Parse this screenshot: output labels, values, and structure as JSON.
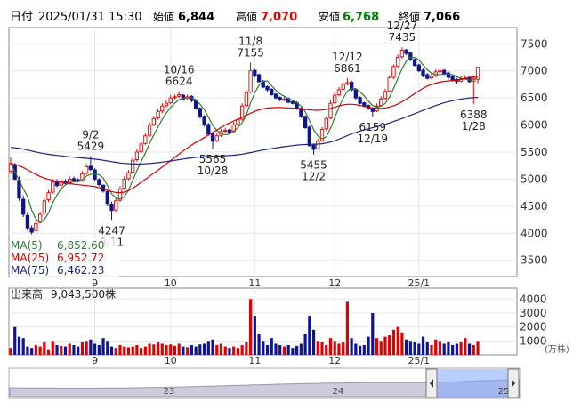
{
  "header": {
    "date_label": "日付",
    "datetime": "2025/01/31 15:30",
    "open_label": "始値",
    "open_value": "6,844",
    "high_label": "高値",
    "high_value": "7,070",
    "low_label": "安値",
    "low_value": "6,768",
    "close_label": "終値",
    "close_value": "7,066"
  },
  "legend": {
    "ma5_label": "MA(5)",
    "ma5_value": "6,852.60",
    "ma25_label": "MA(25)",
    "ma25_value": "6,952.72",
    "ma75_label": "MA(75)",
    "ma75_value": "6,462.23"
  },
  "volume_panel": {
    "label": "出来高",
    "value": "9,043,500株",
    "unit": "(万株)"
  },
  "colors": {
    "up": "#e00000",
    "down": "#10148c",
    "ma5": "#2e7d32",
    "ma25": "#d50000",
    "ma75": "#1a237e",
    "volume_up": "#e00000",
    "volume_down": "#0d1499"
  },
  "chart_data": {
    "type": "candlestick",
    "price_axis": {
      "ticks": [
        "3500",
        "4000",
        "4500",
        "5000",
        "5500",
        "6000",
        "6500",
        "7000",
        "7500"
      ],
      "ylim": [
        3200,
        7800
      ]
    },
    "volume_axis": {
      "ticks": [
        "1000",
        "2000",
        "3000",
        "4000"
      ],
      "ylim": [
        0,
        4400
      ]
    },
    "month_labels": [
      "9",
      "10",
      "11",
      "12",
      "25/1"
    ],
    "overview_labels": [
      "23",
      "24",
      "25"
    ],
    "annotations": [
      {
        "date": "9/2",
        "value": "5429"
      },
      {
        "date": "9/11",
        "value": "4247"
      },
      {
        "date": "10/16",
        "value": "6624"
      },
      {
        "date": "10/28",
        "value": "5565"
      },
      {
        "date": "11/8",
        "value": "7155"
      },
      {
        "date": "12/2",
        "value": "5455"
      },
      {
        "date": "12/12",
        "value": "6861"
      },
      {
        "date": "12/19",
        "value": "6159"
      },
      {
        "date": "12/27",
        "value": "7435"
      },
      {
        "date": "1/28",
        "value": "6388"
      }
    ],
    "close": [
      5290,
      5000,
      4650,
      4350,
      4100,
      4020,
      4180,
      4350,
      4600,
      4750,
      4950,
      4880,
      4950,
      4920,
      5000,
      4980,
      4960,
      5100,
      5230,
      5180,
      5000,
      4900,
      4780,
      4550,
      4420,
      4600,
      4820,
      5000,
      5120,
      5350,
      5500,
      5650,
      5800,
      6000,
      6120,
      6250,
      6350,
      6400,
      6500,
      6520,
      6560,
      6480,
      6520,
      6450,
      6300,
      6150,
      6000,
      5830,
      5700,
      5800,
      5880,
      5900,
      5870,
      6000,
      6100,
      6350,
      6600,
      7000,
      6920,
      6800,
      6700,
      6650,
      6560,
      6500,
      6460,
      6480,
      6420,
      6400,
      6300,
      6150,
      5950,
      5620,
      5550,
      5700,
      5920,
      6120,
      6400,
      6550,
      6650,
      6750,
      6780,
      6650,
      6500,
      6400,
      6350,
      6300,
      6250,
      6350,
      6480,
      6620,
      6870,
      7080,
      7250,
      7380,
      7320,
      7200,
      7100,
      7000,
      6920,
      6860,
      6900,
      6980,
      7000,
      6950,
      6880,
      6830,
      6800,
      6850,
      6870,
      6800,
      6860,
      7066
    ],
    "open": [
      5150,
      5270,
      4980,
      4630,
      4330,
      4100,
      4050,
      4200,
      4370,
      4620,
      4760,
      4960,
      4890,
      4960,
      4930,
      5010,
      4990,
      4970,
      5110,
      5240,
      5170,
      4990,
      4890,
      4770,
      4540,
      4430,
      4610,
      4830,
      5010,
      5130,
      5360,
      5510,
      5660,
      5810,
      6010,
      6130,
      6260,
      6360,
      6410,
      6510,
      6530,
      6550,
      6490,
      6530,
      6460,
      6310,
      6160,
      6010,
      5840,
      5710,
      5810,
      5890,
      5910,
      5880,
      6010,
      6110,
      6360,
      6610,
      7010,
      6930,
      6810,
      6710,
      6660,
      6570,
      6510,
      6470,
      6490,
      6430,
      6410,
      6310,
      6160,
      5960,
      5630,
      5560,
      5710,
      5930,
      6130,
      6410,
      6560,
      6660,
      6760,
      6790,
      6660,
      6510,
      6410,
      6360,
      6310,
      6260,
      6360,
      6490,
      6630,
      6880,
      7090,
      7260,
      7390,
      7330,
      7210,
      7110,
      7010,
      6930,
      6870,
      6910,
      6990,
      7010,
      6960,
      6890,
      6840,
      6810,
      6860,
      6880,
      6810,
      6844
    ],
    "high": [
      5400,
      5300,
      5050,
      4700,
      4400,
      4150,
      4250,
      4400,
      4650,
      4800,
      5000,
      5000,
      4990,
      5000,
      5050,
      5050,
      5020,
      5150,
      5280,
      5429,
      5200,
      5020,
      4900,
      4800,
      4580,
      4650,
      4870,
      5050,
      5170,
      5400,
      5550,
      5700,
      5850,
      6050,
      6170,
      6300,
      6400,
      6450,
      6550,
      6560,
      6624,
      6570,
      6560,
      6550,
      6480,
      6330,
      6180,
      6040,
      5870,
      5850,
      5920,
      5950,
      5930,
      6050,
      6150,
      6400,
      6650,
      7155,
      7030,
      6950,
      6830,
      6730,
      6680,
      6590,
      6530,
      6520,
      6510,
      6450,
      6440,
      6330,
      6180,
      5990,
      5660,
      5750,
      5960,
      6160,
      6450,
      6600,
      6700,
      6800,
      6861,
      6820,
      6680,
      6530,
      6430,
      6380,
      6330,
      6400,
      6530,
      6670,
      6920,
      7120,
      7300,
      7435,
      7400,
      7350,
      7230,
      7130,
      7040,
      6960,
      6950,
      7030,
      7050,
      7030,
      6990,
      6930,
      6870,
      6900,
      6920,
      6900,
      6900,
      7070
    ],
    "low": [
      5100,
      4980,
      4600,
      4300,
      4050,
      3980,
      4030,
      4180,
      4340,
      4580,
      4730,
      4850,
      4870,
      4900,
      4900,
      4950,
      4940,
      4950,
      5080,
      5150,
      4970,
      4870,
      4750,
      4500,
      4247,
      4400,
      4580,
      4800,
      4980,
      5100,
      5320,
      5480,
      5630,
      5780,
      5980,
      6100,
      6220,
      6330,
      6380,
      6480,
      6500,
      6450,
      6460,
      6420,
      6280,
      6120,
      5970,
      5800,
      5565,
      5680,
      5780,
      5860,
      5840,
      5860,
      5980,
      6080,
      6330,
      6580,
      6880,
      6780,
      6680,
      6620,
      6540,
      6480,
      6440,
      6440,
      6400,
      6380,
      6280,
      6130,
      5930,
      5600,
      5455,
      5540,
      5690,
      5900,
      6110,
      6380,
      6530,
      6640,
      6730,
      6620,
      6470,
      6380,
      6330,
      6280,
      6159,
      6240,
      6340,
      6460,
      6600,
      6850,
      7060,
      7230,
      7290,
      7180,
      7080,
      6980,
      6880,
      6840,
      6850,
      6880,
      6960,
      6920,
      6840,
      6800,
      6760,
      6790,
      6840,
      6780,
      6388,
      6768
    ],
    "volume": [
      500,
      2000,
      1300,
      1200,
      600,
      500,
      700,
      600,
      900,
      400,
      1000,
      700,
      650,
      600,
      800,
      700,
      600,
      900,
      1000,
      1100,
      800,
      700,
      1200,
      1000,
      600,
      500,
      700,
      600,
      550,
      600,
      700,
      500,
      600,
      800,
      750,
      900,
      800,
      700,
      750,
      650,
      800,
      600,
      550,
      700,
      600,
      750,
      800,
      1000,
      1100,
      700,
      800,
      600,
      500,
      600,
      500,
      700,
      900,
      4000,
      2800,
      1500,
      1000,
      700,
      1200,
      800,
      700,
      600,
      700,
      500,
      650,
      800,
      1500,
      2800,
      1800,
      1000,
      900,
      700,
      1200,
      1000,
      800,
      900,
      3800,
      1200,
      800,
      650,
      700,
      1300,
      3000,
      1200,
      1000,
      1300,
      1400,
      1800,
      2000,
      1600,
      1100,
      1000,
      900,
      800,
      1300,
      900,
      700,
      1100,
      1000,
      800,
      900,
      700,
      800,
      900,
      1200,
      800,
      700,
      1000
    ]
  }
}
